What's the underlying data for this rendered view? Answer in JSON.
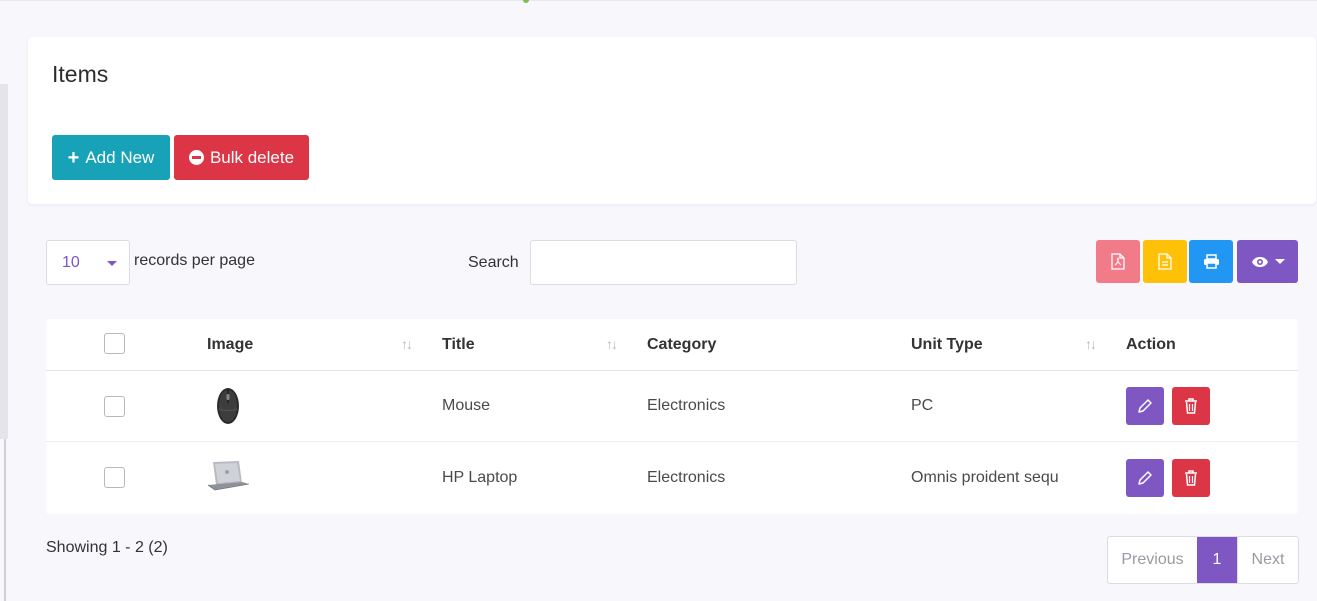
{
  "card": {
    "title": "Items",
    "add_button": "Add New",
    "bulk_delete_button": "Bulk delete"
  },
  "controls": {
    "per_page_value": "10",
    "per_page_label": "records per page",
    "search_label": "Search",
    "search_value": "",
    "export_buttons": [
      "pdf-icon",
      "csv-icon",
      "print-icon",
      "eye-icon"
    ]
  },
  "table": {
    "columns": [
      "",
      "Image",
      "Title",
      "Category",
      "Unit Type",
      "Action"
    ],
    "rows": [
      {
        "image": "mouse",
        "title": "Mouse",
        "category": "Electronics",
        "unit_type": "PC"
      },
      {
        "image": "laptop",
        "title": "HP Laptop",
        "category": "Electronics",
        "unit_type": "Omnis proident sequ"
      }
    ]
  },
  "footer": {
    "showing": "Showing 1 - 2 (2)",
    "prev": "Previous",
    "page": "1",
    "next": "Next"
  },
  "colors": {
    "primary": "#7e57c2",
    "info": "#17a2b8",
    "danger": "#dc3545",
    "warning": "#ffc107",
    "blue": "#2196f3",
    "pdf": "#f27b8a"
  }
}
